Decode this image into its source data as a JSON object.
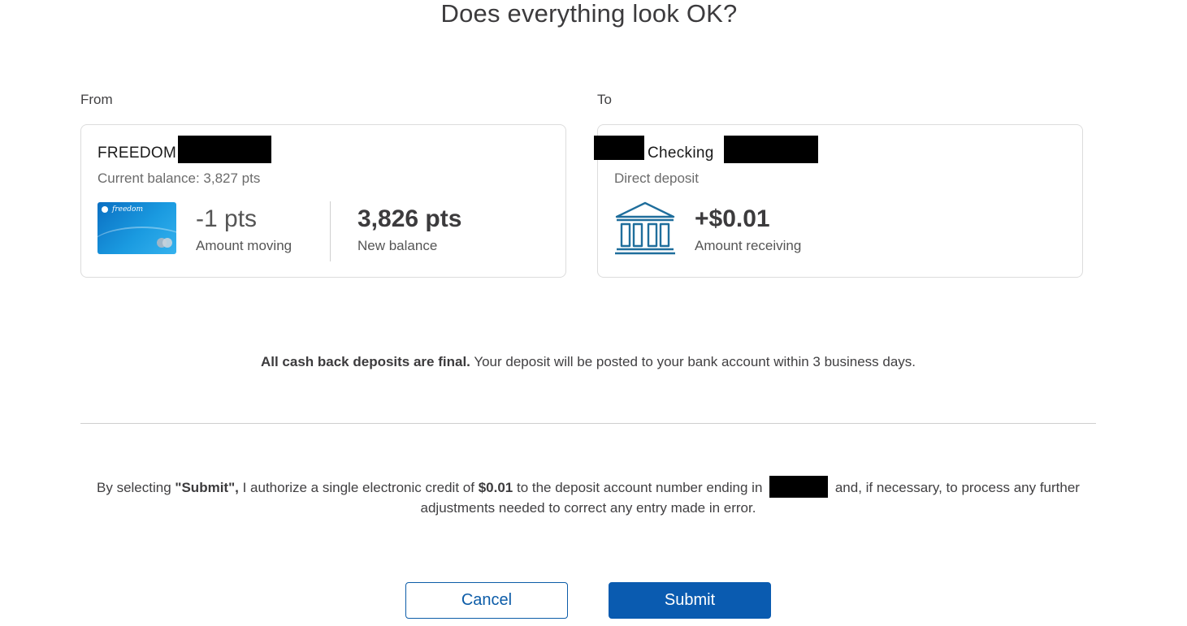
{
  "page": {
    "title": "Does everything look OK?"
  },
  "from": {
    "label": "From",
    "account_name": "FREEDOM",
    "balance_text": "Current balance: 3,827 pts",
    "amount_value": "-1 pts",
    "amount_label": "Amount moving",
    "new_balance_value": "3,826 pts",
    "new_balance_label": "New balance",
    "card_logo_text": "freedom"
  },
  "to": {
    "label": "To",
    "account_name": "Checking",
    "account_type": "Direct deposit",
    "amount_value": "+$0.01",
    "amount_label": "Amount receiving",
    "icon": "bank-icon"
  },
  "notice": {
    "bold": "All cash back deposits are final.",
    "text": " Your deposit will be posted to your bank account within 3 business days."
  },
  "authorization": {
    "prefix": "By selecting ",
    "submit_word": "\"Submit\",",
    "middle": " I authorize a single electronic credit of ",
    "amount": "$0.01",
    "after_amount": " to the deposit account number ending in ",
    "suffix": " and, if necessary, to process any further adjustments needed to correct any entry made in error."
  },
  "actions": {
    "cancel_label": "Cancel",
    "submit_label": "Submit"
  },
  "colors": {
    "primary": "#0a5bb0",
    "text": "#414042",
    "bank_icon": "#1f6e9c"
  }
}
